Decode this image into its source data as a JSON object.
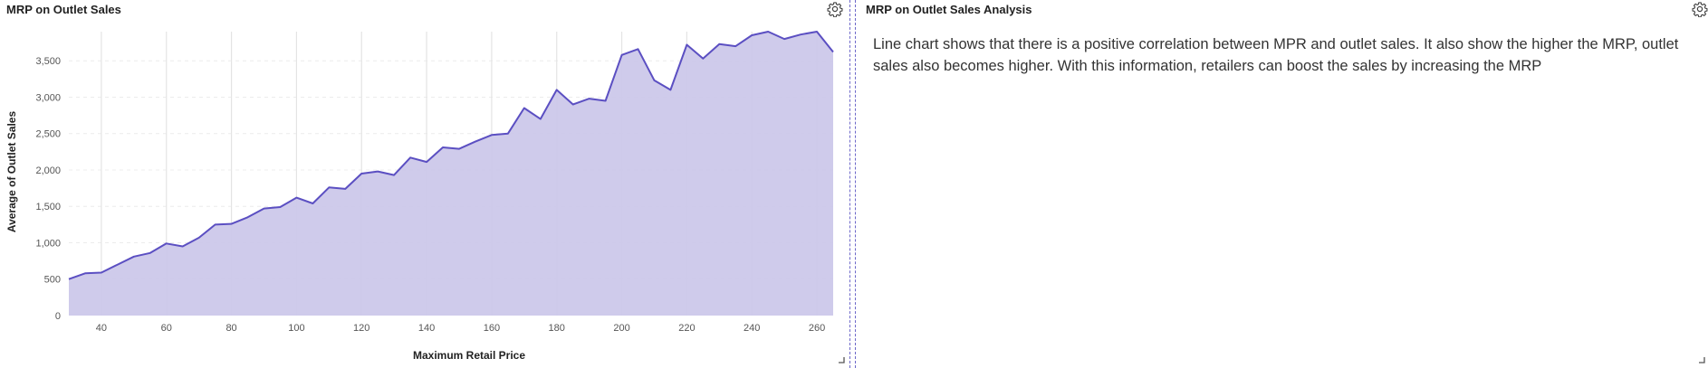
{
  "left_panel": {
    "title": "MRP on Outlet Sales"
  },
  "right_panel": {
    "title": "MRP on Outlet Sales Analysis",
    "text": "Line chart shows that there is a positive correlation between MPR and outlet sales. It also show the higher the MRP, outlet sales also becomes higher. With this information, retailers can boost the sales by increasing the MRP"
  },
  "icons": {
    "settings": "gear-icon",
    "resize": "resize-corner-icon"
  },
  "colors": {
    "line": "#5b4fc2",
    "fill": "#ccc8ea",
    "divider": "#6d68c9"
  },
  "chart_data": {
    "type": "area",
    "title": "MRP on Outlet Sales",
    "xlabel": "Maximum Retail Price",
    "ylabel": "Average of Outlet Sales",
    "xlim": [
      30,
      265
    ],
    "ylim": [
      0,
      3900
    ],
    "x_ticks": [
      40,
      60,
      80,
      100,
      120,
      140,
      160,
      180,
      200,
      220,
      240,
      260
    ],
    "y_ticks": [
      0,
      500,
      1000,
      1500,
      2000,
      2500,
      3000,
      3500
    ],
    "grid": "vertical",
    "x": [
      30,
      35,
      40,
      45,
      50,
      55,
      60,
      65,
      70,
      75,
      80,
      85,
      90,
      95,
      100,
      105,
      110,
      115,
      120,
      125,
      130,
      135,
      140,
      145,
      150,
      155,
      160,
      165,
      170,
      175,
      180,
      185,
      190,
      195,
      200,
      205,
      210,
      215,
      220,
      225,
      230,
      235,
      240,
      245,
      250,
      255,
      260,
      265
    ],
    "series": [
      {
        "values": [
          500,
          580,
          590,
          700,
          810,
          860,
          990,
          950,
          1070,
          1250,
          1260,
          1350,
          1470,
          1490,
          1620,
          1540,
          1760,
          1740,
          1950,
          1980,
          1930,
          2170,
          2110,
          2310,
          2290,
          2390,
          2480,
          2500,
          2850,
          2700,
          3100,
          2900,
          2980,
          2950,
          3580,
          3660,
          3230,
          3100,
          3720,
          3530,
          3730,
          3700,
          3850,
          3900,
          3800,
          3860,
          3900,
          3620
        ]
      }
    ]
  }
}
